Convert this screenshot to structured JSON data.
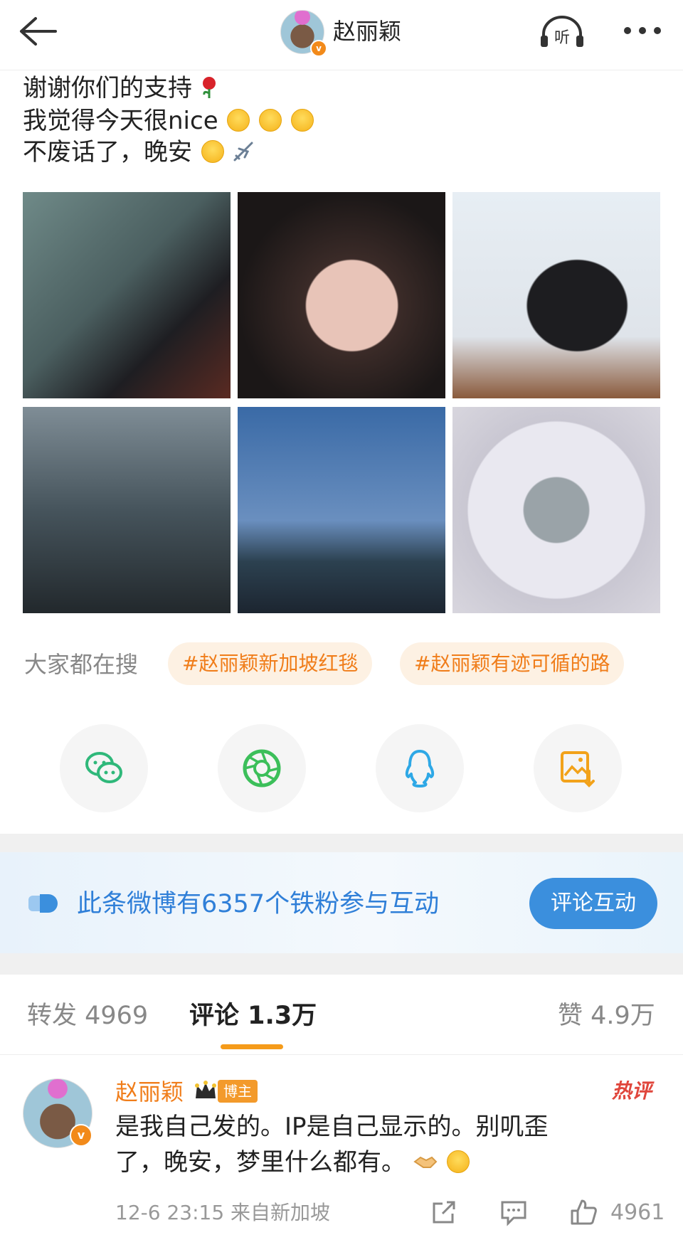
{
  "header": {
    "username": "赵丽颖",
    "verified_badge": "v",
    "listen_label": "听"
  },
  "post": {
    "lines": [
      "谢谢你们的支持",
      "我觉得今天很nice",
      "不废话了，晚安"
    ],
    "line1_emoji": "rose-emoji",
    "line2_emoji": "smile-emoji x3",
    "line3_emoji": "birthday-face, airplane"
  },
  "photos": [
    {
      "name": "photo-1"
    },
    {
      "name": "photo-2"
    },
    {
      "name": "photo-3"
    },
    {
      "name": "photo-4"
    },
    {
      "name": "photo-5"
    },
    {
      "name": "photo-6"
    }
  ],
  "search": {
    "label": "大家都在搜",
    "tags": [
      "#赵丽颖新加坡红毯",
      "#赵丽颖有迹可循的路"
    ]
  },
  "share": {
    "icons": [
      "wechat-icon",
      "moments-icon",
      "qq-icon",
      "save-image-icon"
    ]
  },
  "fans": {
    "text": "此条微博有6357个铁粉参与互动",
    "button": "评论互动"
  },
  "tabs": {
    "repost": "转发 4969",
    "comment": "评论 1.3万",
    "like": "赞 4.9万"
  },
  "comment": {
    "name": "赵丽颖",
    "role_badge": "博主",
    "hot_label": "热评",
    "lines": [
      "是我自己发的。IP是自己显示的。别叽歪",
      "了，晚安，梦里什么都有。"
    ],
    "meta": "12-6 23:15  来自新加坡",
    "likes": "4961"
  },
  "colors": {
    "accent": "#f07d1a",
    "blue": "#2f7fd8",
    "tag_bg": "#fdf1e3",
    "separator": "#f0f0f0"
  }
}
